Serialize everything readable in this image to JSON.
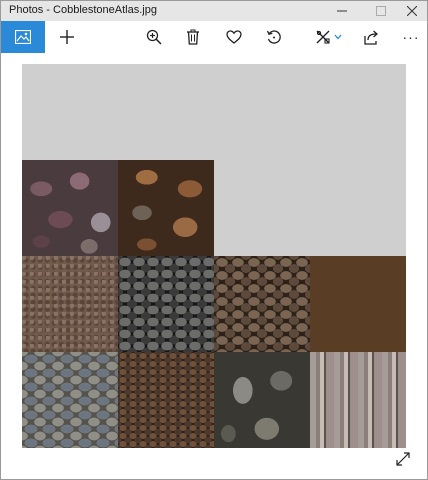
{
  "window": {
    "title": "Photos - CobblestoneAtlas.jpg",
    "controls": [
      "minimize-icon",
      "maximize-icon",
      "close-icon"
    ]
  },
  "toolbar": {
    "items": [
      {
        "name": "gallery",
        "icon": "photo-gallery-icon",
        "active": true
      },
      {
        "name": "add",
        "icon": "plus-icon"
      },
      {
        "name": "zoom",
        "icon": "zoom-in-icon"
      },
      {
        "name": "delete",
        "icon": "trash-icon"
      },
      {
        "name": "favorite",
        "icon": "heart-icon"
      },
      {
        "name": "rotate",
        "icon": "rotate-icon"
      },
      {
        "name": "edit",
        "icon": "edit-draw-icon",
        "has_dropdown": true
      },
      {
        "name": "share",
        "icon": "share-icon"
      },
      {
        "name": "more",
        "icon": "more-icon",
        "label": "···"
      }
    ],
    "accent_color": "#2b8ad8"
  },
  "image": {
    "file": "CobblestoneAtlas.jpg",
    "background_color": "#cfcfcf",
    "tiles": [
      {
        "row": 1,
        "col": 0,
        "texture": "purple-flagstone"
      },
      {
        "row": 1,
        "col": 1,
        "texture": "brown-fieldstone"
      },
      {
        "row": 2,
        "col": 0,
        "texture": "gravel"
      },
      {
        "row": 2,
        "col": 1,
        "texture": "dark-cobble"
      },
      {
        "row": 2,
        "col": 2,
        "texture": "river-stone"
      },
      {
        "row": 2,
        "col": 3,
        "texture": "sandstone-block"
      },
      {
        "row": 3,
        "col": 0,
        "texture": "grey-cobble"
      },
      {
        "row": 3,
        "col": 1,
        "texture": "brown-pebble"
      },
      {
        "row": 3,
        "col": 2,
        "texture": "grey-fieldstone"
      },
      {
        "row": 3,
        "col": 3,
        "texture": "slate-strip"
      }
    ]
  },
  "footer": {
    "expand_icon": "fullscreen-expand-icon"
  }
}
